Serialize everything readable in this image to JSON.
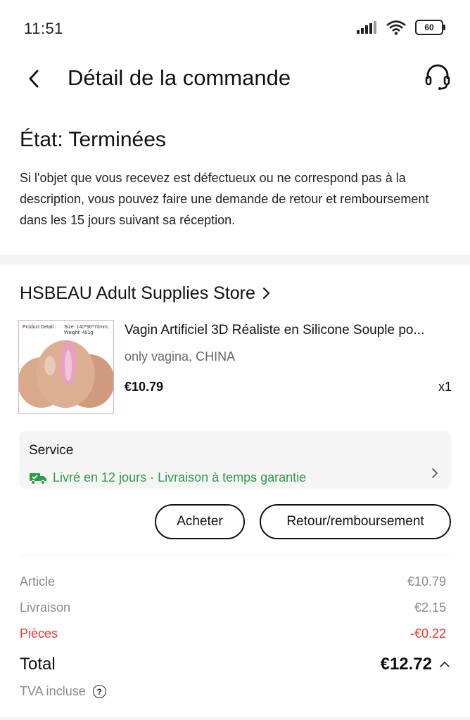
{
  "status_bar": {
    "time": "11:51",
    "battery": "60",
    "icons": [
      "signal-icon",
      "wifi-icon",
      "battery-icon"
    ]
  },
  "header": {
    "title": "Détail de la commande",
    "back_icon": "back-arrow-icon",
    "support_icon": "headset-icon"
  },
  "order_state": {
    "title": "État: Terminées",
    "description": "Si l'objet que vous recevez est défectueux ou ne correspond pas à la description, vous pouvez faire une demande de retour et remboursement dans les 15 jours suivant sa réception."
  },
  "store": {
    "name": "HSBEAU Adult Supplies Store",
    "chevron": "›"
  },
  "product": {
    "title": "Vagin Artificiel 3D Réaliste en Silicone Souple po...",
    "variant": "only vagina, CHINA",
    "price": "€10.79",
    "quantity": "x1",
    "image_caption": "Product Detail :",
    "image_size": "Size: 140*90*70mm; Weight: 401g"
  },
  "service": {
    "title": "Service",
    "delivery_text": "Livré en 12 jours · Livraison à temps garantie",
    "icon": "truck-icon",
    "color": "#2e9a4a"
  },
  "actions": {
    "buy_again": "Acheter",
    "return_refund": "Retour/remboursement"
  },
  "summary": {
    "article_label": "Article",
    "article_value": "€10.79",
    "shipping_label": "Livraison",
    "shipping_value": "€2.15",
    "coins_label": "Pièces",
    "coins_value": "-€0.22",
    "total_label": "Total",
    "total_value": "€12.72",
    "vat_label": "TVA incluse",
    "discount_color": "#e2392c"
  }
}
